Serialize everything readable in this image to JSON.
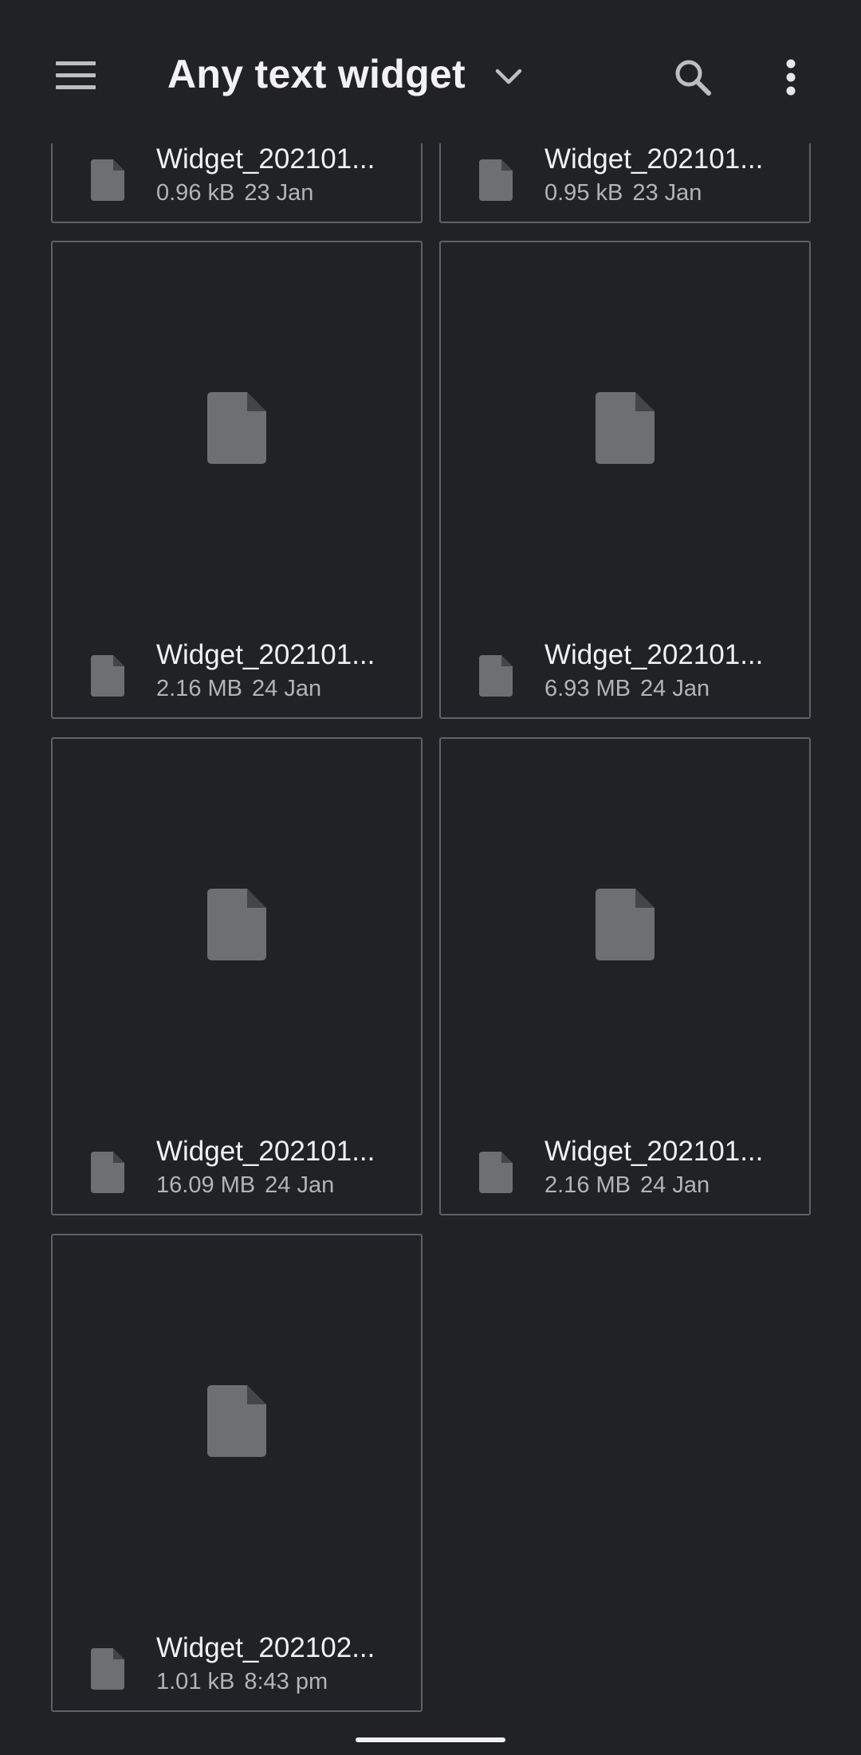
{
  "appbar": {
    "title": "Any text widget",
    "menu_icon": "hamburger-menu-icon",
    "dropdown_icon": "chevron-down-icon",
    "search_icon": "search-icon",
    "more_icon": "more-vert-icon"
  },
  "colors": {
    "background": "#212226",
    "card_border": "#5f6166",
    "icon_gray": "#6e6f73",
    "primary_text": "#f1f1f1",
    "secondary_text": "#b3b4b8"
  },
  "files": [
    {
      "name": "Widget_202101...",
      "size": "0.96 kB",
      "date": "23 Jan"
    },
    {
      "name": "Widget_202101...",
      "size": "0.95 kB",
      "date": "23 Jan"
    },
    {
      "name": "Widget_202101...",
      "size": "2.16 MB",
      "date": "24 Jan"
    },
    {
      "name": "Widget_202101...",
      "size": "6.93 MB",
      "date": "24 Jan"
    },
    {
      "name": "Widget_202101...",
      "size": "16.09 MB",
      "date": "24 Jan"
    },
    {
      "name": "Widget_202101...",
      "size": "2.16 MB",
      "date": "24 Jan"
    },
    {
      "name": "Widget_202102...",
      "size": "1.01 kB",
      "date": "8:43 pm"
    }
  ]
}
